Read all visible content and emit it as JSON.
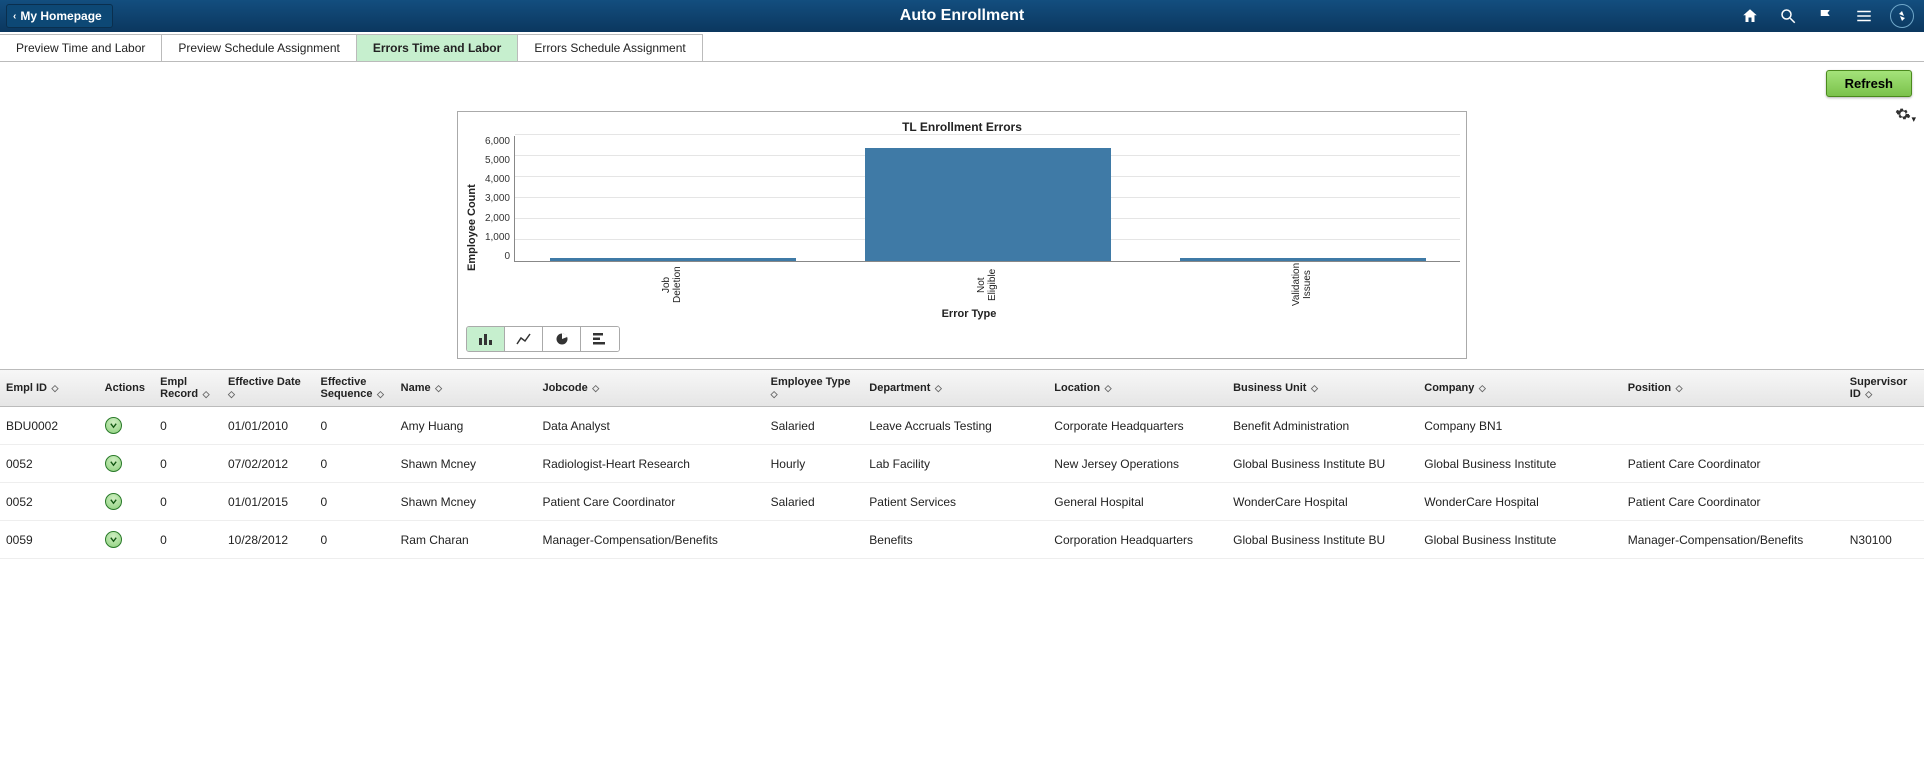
{
  "header": {
    "back_label": "My Homepage",
    "title": "Auto Enrollment"
  },
  "tabs": [
    {
      "label": "Preview Time and Labor"
    },
    {
      "label": "Preview Schedule Assignment"
    },
    {
      "label": "Errors Time and Labor"
    },
    {
      "label": "Errors Schedule Assignment"
    }
  ],
  "active_tab_index": 2,
  "buttons": {
    "refresh": "Refresh"
  },
  "chart_data": {
    "type": "bar",
    "title": "TL Enrollment Errors",
    "xlabel": "Error Type",
    "ylabel": "Employee Count",
    "ylim": [
      0,
      6000
    ],
    "yticks": [
      0,
      1000,
      2000,
      3000,
      4000,
      5000,
      6000
    ],
    "ytick_labels": [
      "0",
      "1,000",
      "2,000",
      "3,000",
      "4,000",
      "5,000",
      "6,000"
    ],
    "categories": [
      "Job Deletion",
      "Not Eligible",
      "Validation Issues"
    ],
    "values": [
      150,
      5400,
      150
    ]
  },
  "table": {
    "columns": [
      {
        "label": "Empl ID",
        "sortable": true
      },
      {
        "label": "Actions",
        "sortable": false
      },
      {
        "label": "Empl Record",
        "sortable": true
      },
      {
        "label": "Effective Date",
        "sortable": true
      },
      {
        "label": "Effective Sequence",
        "sortable": true
      },
      {
        "label": "Name",
        "sortable": true
      },
      {
        "label": "Jobcode",
        "sortable": true
      },
      {
        "label": "Employee Type",
        "sortable": true
      },
      {
        "label": "Department",
        "sortable": true
      },
      {
        "label": "Location",
        "sortable": true
      },
      {
        "label": "Business Unit",
        "sortable": true
      },
      {
        "label": "Company",
        "sortable": true
      },
      {
        "label": "Position",
        "sortable": true
      },
      {
        "label": "Supervisor ID",
        "sortable": true
      }
    ],
    "rows": [
      {
        "empl_id": "BDU0002",
        "empl_record": "0",
        "eff_date": "01/01/2010",
        "eff_seq": "0",
        "name": "Amy Huang",
        "jobcode": "Data Analyst",
        "etype": "Salaried",
        "dept": "Leave Accruals Testing",
        "loc": "Corporate Headquarters",
        "bu": "Benefit Administration",
        "company": "Company BN1",
        "position": "",
        "sup": ""
      },
      {
        "empl_id": "0052",
        "empl_record": "0",
        "eff_date": "07/02/2012",
        "eff_seq": "0",
        "name": "Shawn Mcney",
        "jobcode": "Radiologist-Heart Research",
        "etype": "Hourly",
        "dept": "Lab Facility",
        "loc": "New Jersey Operations",
        "bu": "Global Business Institute BU",
        "company": "Global Business Institute",
        "position": "Patient Care Coordinator",
        "sup": ""
      },
      {
        "empl_id": "0052",
        "empl_record": "0",
        "eff_date": "01/01/2015",
        "eff_seq": "0",
        "name": "Shawn Mcney",
        "jobcode": "Patient Care Coordinator",
        "etype": "Salaried",
        "dept": "Patient Services",
        "loc": "General Hospital",
        "bu": "WonderCare Hospital",
        "company": "WonderCare Hospital",
        "position": "Patient Care Coordinator",
        "sup": ""
      },
      {
        "empl_id": "0059",
        "empl_record": "0",
        "eff_date": "10/28/2012",
        "eff_seq": "0",
        "name": "Ram Charan",
        "jobcode": "Manager-Compensation/Benefits",
        "etype": "",
        "dept": "Benefits",
        "loc": "Corporation Headquarters",
        "bu": "Global Business Institute BU",
        "company": "Global Business Institute",
        "position": "Manager-Compensation/Benefits",
        "sup": "N30100"
      }
    ]
  }
}
